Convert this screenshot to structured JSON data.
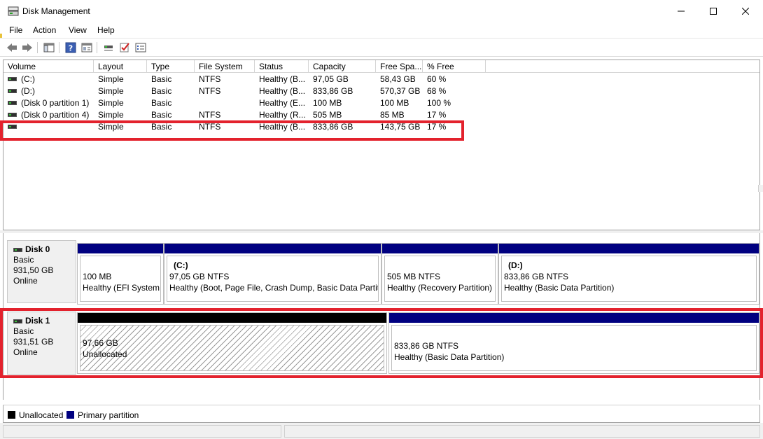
{
  "window": {
    "title": "Disk Management",
    "controls": {
      "minimize": "—",
      "maximize": "☐",
      "close": "✕"
    }
  },
  "menu": [
    "File",
    "Action",
    "View",
    "Help"
  ],
  "toolbar": {
    "icons": [
      "back-arrow-icon",
      "forward-arrow-icon",
      "console-tree-icon",
      "help-icon",
      "properties-icon",
      "connect-icon",
      "check-icon",
      "list-icon"
    ]
  },
  "volume_table": {
    "columns": [
      "Volume",
      "Layout",
      "Type",
      "File System",
      "Status",
      "Capacity",
      "Free Spa...",
      "% Free"
    ],
    "rows": [
      [
        "(C:)",
        "Simple",
        "Basic",
        "NTFS",
        "Healthy (B...",
        "97,05 GB",
        "58,43 GB",
        "60 %"
      ],
      [
        "(D:)",
        "Simple",
        "Basic",
        "NTFS",
        "Healthy (B...",
        "833,86 GB",
        "570,37 GB",
        "68 %"
      ],
      [
        "(Disk 0 partition 1)",
        "Simple",
        "Basic",
        "",
        "Healthy (E...",
        "100 MB",
        "100 MB",
        "100 %"
      ],
      [
        "(Disk 0 partition 4)",
        "Simple",
        "Basic",
        "NTFS",
        "Healthy (R...",
        "505 MB",
        "85 MB",
        "17 %"
      ],
      [
        "",
        "Simple",
        "Basic",
        "NTFS",
        "Healthy (B...",
        "833,86 GB",
        "143,75 GB",
        "17 %"
      ]
    ]
  },
  "disks": [
    {
      "name": "Disk 0",
      "type": "Basic",
      "size": "931,50 GB",
      "state": "Online",
      "partitions": [
        {
          "title": "",
          "size": "100 MB",
          "status": "Healthy (EFI System"
        },
        {
          "title": "(C:)",
          "size": "97,05 GB NTFS",
          "status": "Healthy (Boot, Page File, Crash Dump, Basic Data Partitio"
        },
        {
          "title": "",
          "size": "505 MB NTFS",
          "status": "Healthy (Recovery Partition)"
        },
        {
          "title": "(D:)",
          "size": "833,86 GB NTFS",
          "status": "Healthy (Basic Data Partition)"
        }
      ]
    },
    {
      "name": "Disk 1",
      "type": "Basic",
      "size": "931,51 GB",
      "state": "Online",
      "partitions": [
        {
          "title": "",
          "size": "97,66 GB",
          "status": "Unallocated"
        },
        {
          "title": "",
          "size": "833,86 GB NTFS",
          "status": "Healthy (Basic Data Partition)"
        }
      ]
    }
  ],
  "legend": [
    {
      "label": "Unallocated",
      "color": "#000000"
    },
    {
      "label": "Primary partition",
      "color": "#000080"
    }
  ],
  "colors": {
    "primary": "#000080",
    "unallocated": "#000000",
    "highlight": "#e3222d"
  }
}
